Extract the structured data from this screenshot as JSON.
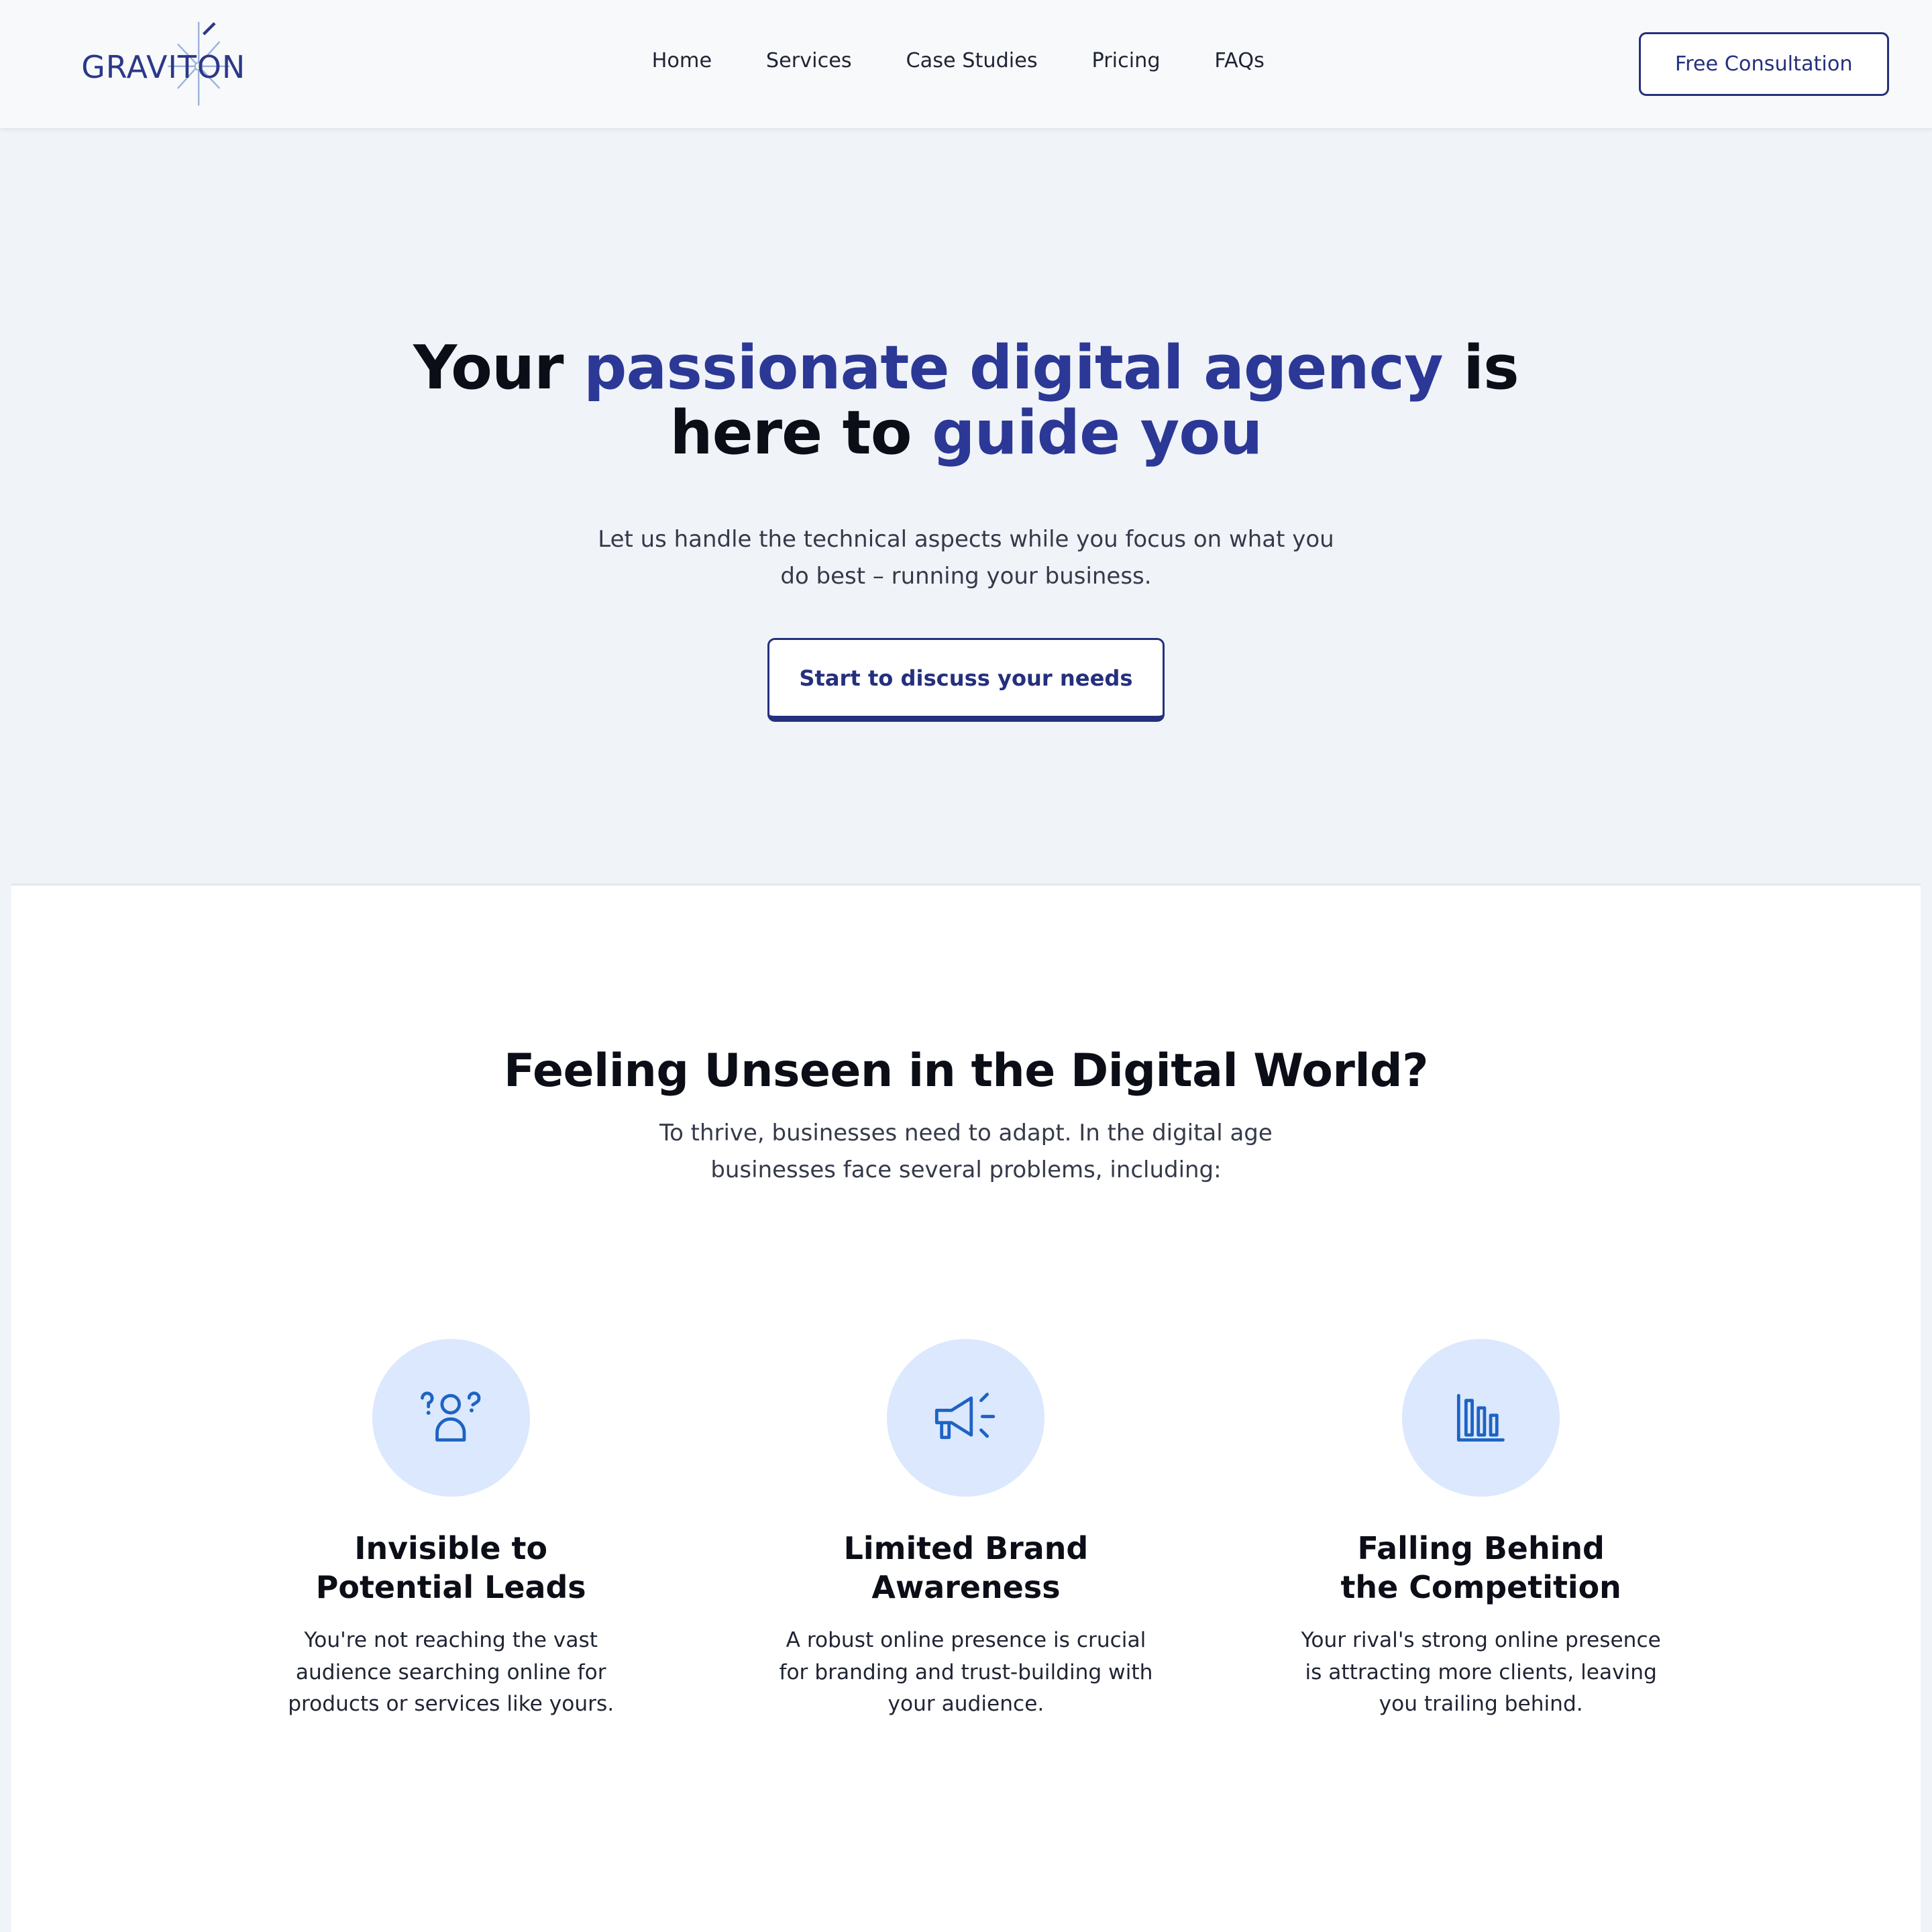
{
  "header": {
    "logo_text": "GRAVITON",
    "nav": [
      "Home",
      "Services",
      "Case Studies",
      "Pricing",
      "FAQs"
    ],
    "cta_label": "Free Consultation"
  },
  "hero": {
    "title_part1": "Your ",
    "title_accent1": "passionate digital agency",
    "title_part2": " is here to ",
    "title_accent2": "guide you",
    "subtitle": "Let us handle the technical aspects while you focus on what you do best – running your business.",
    "button_label": "Start to discuss your needs"
  },
  "problems": {
    "title": "Feeling Unseen in the Digital World?",
    "subtitle": "To thrive, businesses need to adapt. In the digital age businesses face several problems, including:",
    "cards": [
      {
        "icon": "confused-person-icon",
        "title": "Invisible to Potential Leads",
        "text": "You're not reaching the vast audience searching online for products or services like yours."
      },
      {
        "icon": "megaphone-icon",
        "title": "Limited Brand Awareness",
        "text": "A robust online presence is crucial for branding and trust-building with your audience."
      },
      {
        "icon": "bar-chart-icon",
        "title": "Falling Behind the Competition",
        "text": "Your rival's strong online presence is attracting more clients, leaving you trailing behind."
      }
    ]
  },
  "colors": {
    "accent": "#2b3896",
    "button_border": "#25307d",
    "icon_blue": "#1e63c4",
    "icon_bg": "#dbe8fd",
    "page_bg": "#f0f3f8"
  }
}
